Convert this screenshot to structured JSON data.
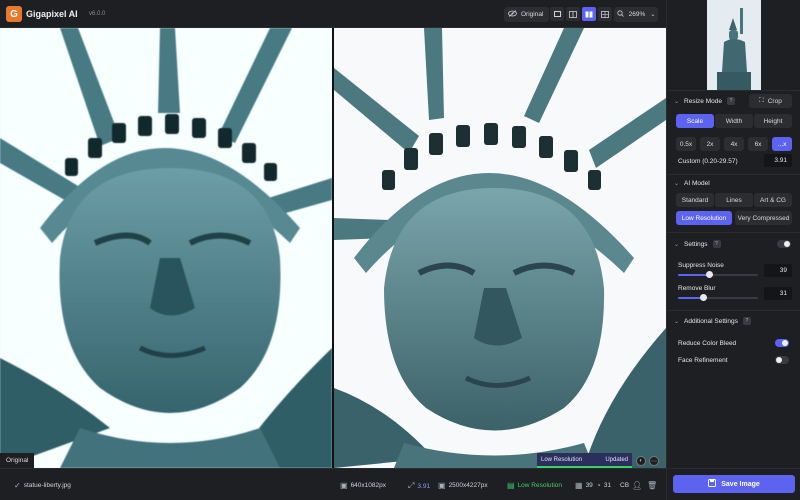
{
  "app": {
    "name": "Gigapixel AI",
    "version": "v6.0.0",
    "logo_letter": "G"
  },
  "toolbar": {
    "original_label": "Original",
    "zoom": "269%",
    "zoom_chevron": "⌄"
  },
  "viewer": {
    "left_label": "Original",
    "model_label": "Low Resolution",
    "model_status": "Updated"
  },
  "bottom": {
    "file_name": "statue-liberty.jpg",
    "input_size": "640x1082px",
    "scale": "3.91",
    "output_size": "2500x4227px",
    "model": "Low Resolution",
    "noise_value": "39",
    "blur_value": "31",
    "format": "CB"
  },
  "sidebar": {
    "resize_mode": {
      "title": "Resize Mode",
      "help": "?",
      "crop_label": "Crop",
      "tabs": [
        "Scale",
        "Width",
        "Height"
      ],
      "scales": [
        "0.5x",
        "2x",
        "4x",
        "6x",
        "...x"
      ],
      "custom_label": "Custom (0.20-29.57)",
      "custom_value": "3.91"
    },
    "ai_model": {
      "title": "AI Model",
      "models_row1": [
        "Standard",
        "Lines",
        "Art & CG"
      ],
      "models_row2": [
        "Low Resolution",
        "Very Compressed"
      ]
    },
    "settings": {
      "title": "Settings",
      "suppress_noise_label": "Suppress Noise",
      "suppress_noise_value": "39",
      "suppress_noise_level": 0.39,
      "remove_blur_label": "Remove Blur",
      "remove_blur_value": "31",
      "remove_blur_level": 0.31
    },
    "additional": {
      "title": "Additional Settings",
      "color_bleed_label": "Reduce Color Bleed",
      "face_refine_label": "Face Refinement"
    },
    "save_label": "Save Image"
  },
  "colors": {
    "accent": "#5b63f0",
    "success": "#3fcf6a",
    "brand": "#e8792c"
  }
}
